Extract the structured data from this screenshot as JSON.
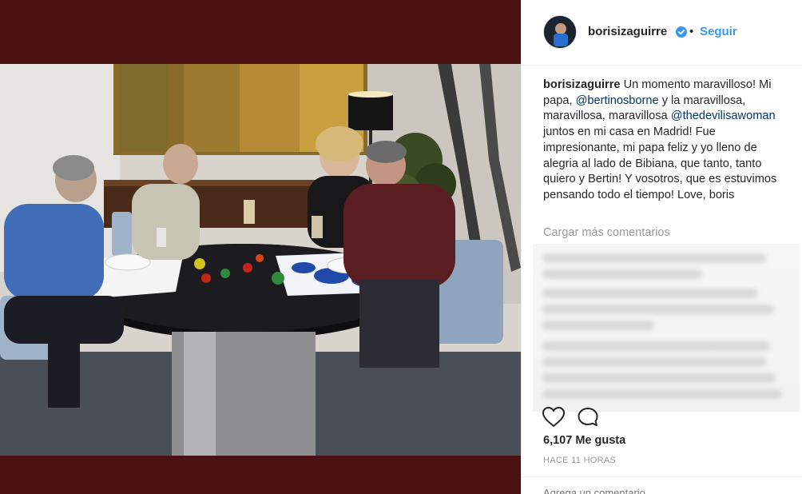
{
  "post": {
    "username": "borisizaguirre",
    "verified": true,
    "separator": "•",
    "follow_label": "Seguir",
    "caption_user": "borisizaguirre",
    "caption_parts": [
      {
        "type": "text",
        "text": " Un momento maravilloso! Mi papa, "
      },
      {
        "type": "mention",
        "text": "@bertinosborne"
      },
      {
        "type": "text",
        "text": " y la maravillosa, maravillosa, maravillosa "
      },
      {
        "type": "mention",
        "text": "@thedevilisawoman"
      },
      {
        "type": "text",
        "text": " juntos en mi casa en Madrid! Fue impresionante, mi papa feliz y yo lleno de alegria al lado de Bibiana, que tanto, tanto quiero y Bertin! Y vosotros, que es estuvimos pensando todo el tiempo! Love, boris"
      }
    ],
    "load_more_label": "Cargar más comentarios",
    "likes_text": "6,107 Me gusta",
    "time_text": "HACE 11 HORAS",
    "comment_placeholder": "Agrega un comentario..."
  },
  "icons": {
    "verified": "verified-badge-icon",
    "like": "heart-icon",
    "comment": "comment-icon"
  },
  "colors": {
    "background": "#4a1212",
    "link": "#3897f0",
    "mention": "#003569",
    "muted": "#999999"
  }
}
